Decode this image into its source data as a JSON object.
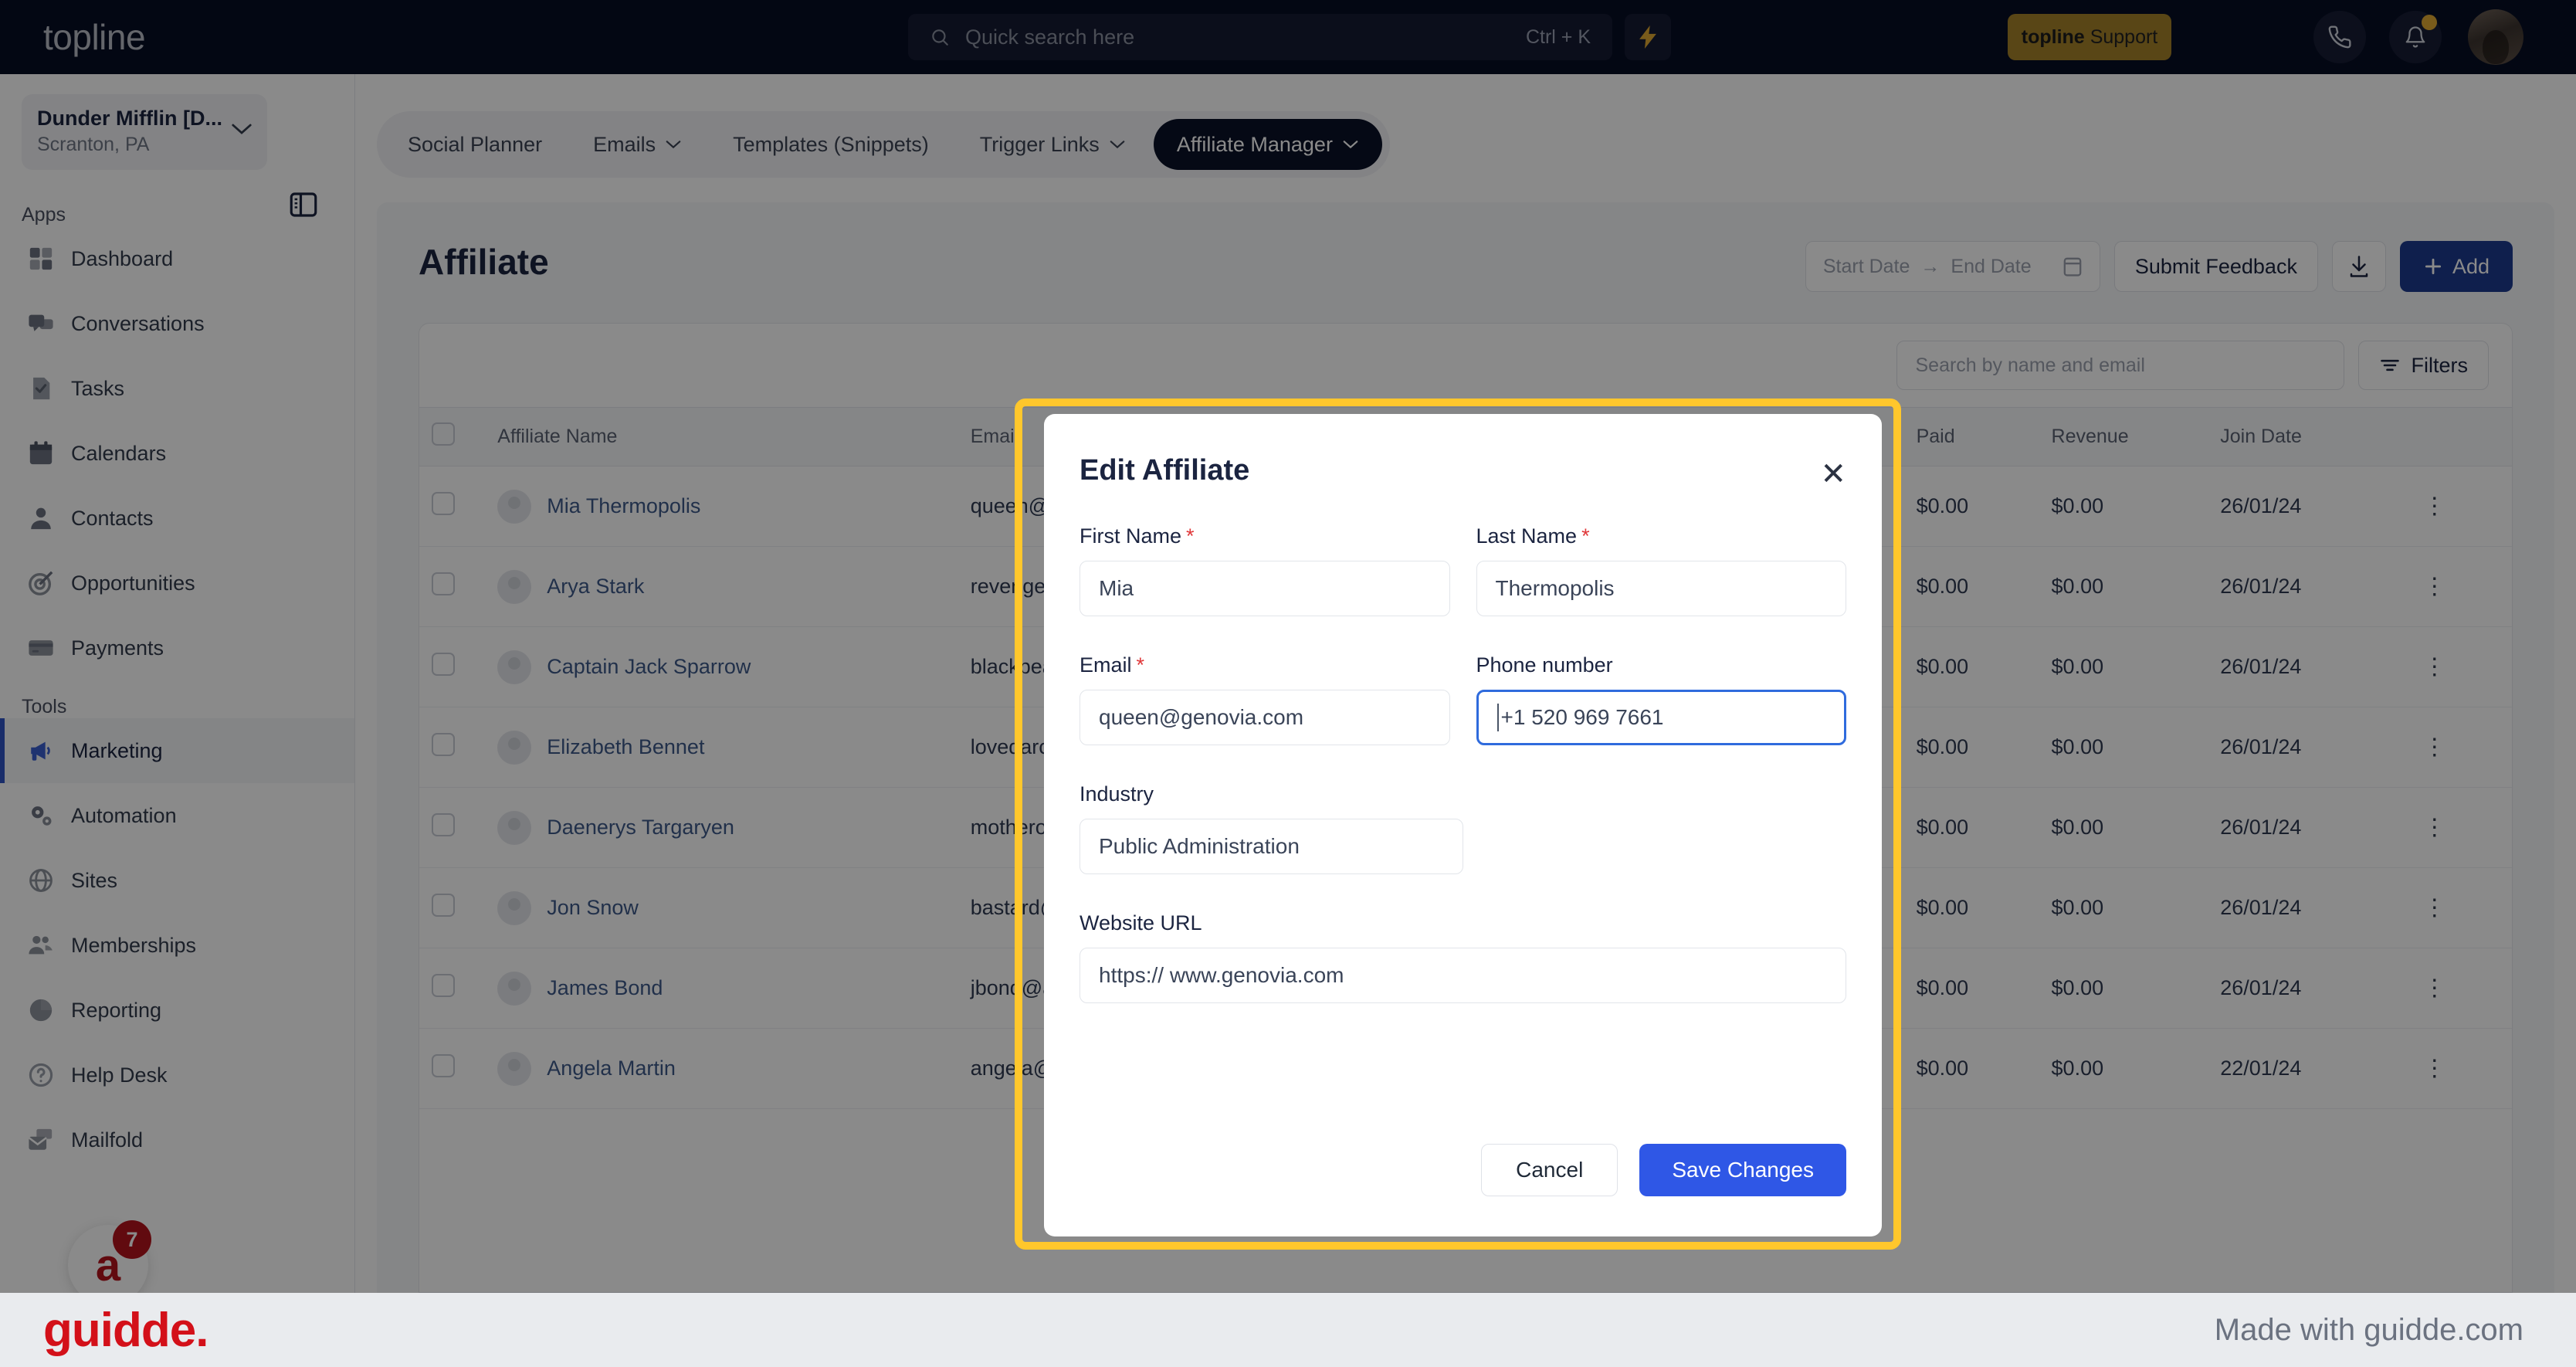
{
  "topbar": {
    "logo": "topline",
    "search": {
      "placeholder": "Quick search here",
      "shortcut": "Ctrl + K",
      "icon": "search-icon"
    },
    "bolt_icon": "lightning-bolt-icon",
    "support_button": {
      "brand": "topline",
      "label": "Support"
    },
    "phone_icon": "phone-icon",
    "bell_icon": "bell-icon",
    "avatar": "user-avatar"
  },
  "sidebar": {
    "location": {
      "name": "Dunder Mifflin [D...",
      "sub": "Scranton, PA"
    },
    "panel_toggle_icon": "panel-toggle-icon",
    "sections": [
      {
        "label": "Apps",
        "items": [
          {
            "label": "Dashboard",
            "icon": "dashboard-icon"
          },
          {
            "label": "Conversations",
            "icon": "conversations-icon"
          },
          {
            "label": "Tasks",
            "icon": "tasks-icon"
          },
          {
            "label": "Calendars",
            "icon": "calendar-icon"
          },
          {
            "label": "Contacts",
            "icon": "contacts-icon"
          },
          {
            "label": "Opportunities",
            "icon": "target-icon"
          },
          {
            "label": "Payments",
            "icon": "card-icon"
          }
        ]
      },
      {
        "label": "Tools",
        "items": [
          {
            "label": "Marketing",
            "icon": "megaphone-icon",
            "active": true
          },
          {
            "label": "Automation",
            "icon": "gears-icon"
          },
          {
            "label": "Sites",
            "icon": "globe-icon"
          },
          {
            "label": "Memberships",
            "icon": "members-icon"
          },
          {
            "label": "Reporting",
            "icon": "pie-chart-icon"
          },
          {
            "label": "Help Desk",
            "icon": "question-circle-icon"
          },
          {
            "label": "Mailfold",
            "icon": "mail-stack-icon"
          }
        ]
      }
    ],
    "chat_fab": {
      "glyph": "a",
      "badge": "7"
    }
  },
  "tabs": [
    {
      "label": "Social Planner",
      "caret": false,
      "active": false
    },
    {
      "label": "Emails",
      "caret": true,
      "active": false
    },
    {
      "label": "Templates (Snippets)",
      "caret": false,
      "active": false
    },
    {
      "label": "Trigger Links",
      "caret": true,
      "active": false
    },
    {
      "label": "Affiliate Manager",
      "caret": true,
      "active": true
    }
  ],
  "page": {
    "title": "Affiliate",
    "toolbar": {
      "start_date_placeholder": "Start Date",
      "range_arrow": "→",
      "end_date_placeholder": "End Date",
      "calendar_icon": "calendar-icon",
      "submit_feedback": "Submit Feedback",
      "download_icon": "download-icon",
      "add_button": "Add",
      "add_icon": "plus-icon"
    },
    "panel": {
      "search_placeholder": "Search by name and email",
      "filters_label": "Filters",
      "filters_icon": "filter-icon"
    }
  },
  "table": {
    "columns": [
      "Affiliate Name",
      "Email",
      "Paid",
      "Revenue",
      "Join Date"
    ],
    "rows": [
      {
        "name": "Mia Thermopolis",
        "email": "queen@genovia.com",
        "paid": "$0.00",
        "revenue": "$0.00",
        "join": "26/01/24"
      },
      {
        "name": "Arya Stark",
        "email": "revenge@winterfell.com",
        "paid": "$0.00",
        "revenue": "$0.00",
        "join": "26/01/24"
      },
      {
        "name": "Captain Jack Sparrow",
        "email": "blackpearl@sea.com",
        "paid": "$0.00",
        "revenue": "$0.00",
        "join": "26/01/24"
      },
      {
        "name": "Elizabeth Bennet",
        "email": "lovedarcy@longbourn.com",
        "paid": "$0.00",
        "revenue": "$0.00",
        "join": "26/01/24"
      },
      {
        "name": "Daenerys Targaryen",
        "email": "motherofdragons@got.com",
        "paid": "$0.00",
        "revenue": "$0.00",
        "join": "26/01/24"
      },
      {
        "name": "Jon Snow",
        "email": "bastard@winterfell.com",
        "paid": "$0.00",
        "revenue": "$0.00",
        "join": "26/01/24"
      },
      {
        "name": "James Bond",
        "email": "jbond@agency.com",
        "paid": "$0.00",
        "revenue": "$0.00",
        "join": "26/01/24"
      },
      {
        "name": "Angela Martin",
        "email": "angela@dundermifflin.com",
        "paid": "$0.00",
        "revenue": "$0.00",
        "join": "22/01/24"
      }
    ],
    "kebab": "⋮"
  },
  "modal": {
    "title": "Edit Affiliate",
    "close_icon": "close-icon",
    "fields": {
      "first_name": {
        "label": "First Name",
        "required": true,
        "value": "Mia"
      },
      "last_name": {
        "label": "Last Name",
        "required": true,
        "value": "Thermopolis"
      },
      "email": {
        "label": "Email",
        "required": true,
        "value": "queen@genovia.com"
      },
      "phone": {
        "label": "Phone number",
        "required": false,
        "value": "+1 520 969 7661",
        "focused": true
      },
      "industry": {
        "label": "Industry",
        "required": false,
        "value": "Public Administration"
      },
      "website": {
        "label": "Website URL",
        "required": false,
        "value": "https:// www.genovia.com"
      }
    },
    "cancel": "Cancel",
    "save": "Save Changes"
  },
  "footer": {
    "logo": "guidde.",
    "made_with": "Made with guidde.com"
  },
  "colors": {
    "topbar_bg": "#070d24",
    "support_gold": "#a4812a",
    "highlight": "#ffc72c",
    "primary_blue": "#2f57e6",
    "add_blue": "#1d3a8f",
    "active_tab": "#0b1127",
    "required_red": "#e0383a",
    "guidde_red": "#d31019",
    "badge_red": "#b4141c"
  }
}
